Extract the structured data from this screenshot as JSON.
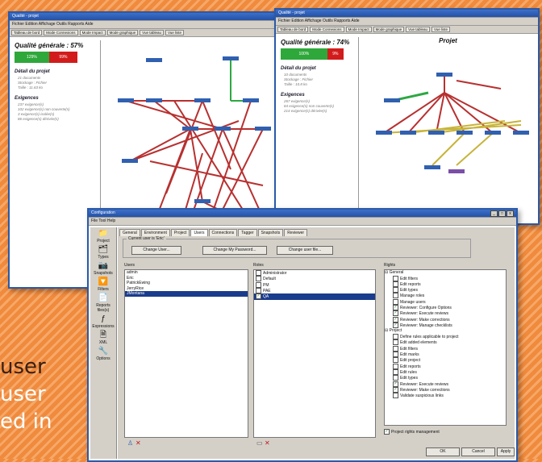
{
  "slide": {
    "line1": "user",
    "line2": "user",
    "line3": "ed in"
  },
  "win1": {
    "title": "Qualité - projet",
    "menu": "Fichier Edition Affichage Outils Rapports Aide",
    "tabs": [
      "Tableau de bord",
      "Mode Connexions",
      "Mode Impact",
      "Mode graphique",
      "Vue tableau",
      "Vue liste"
    ],
    "quality": "Qualité générale : 57%",
    "bar_pass": "129%",
    "bar_fail": "99%",
    "detail_title": "Détail du projet",
    "detail": [
      "21 documents",
      "Stockage : Fichier",
      "Taille : 11.63 ko"
    ],
    "req_title": "Exigences",
    "req": [
      "237 exigence(s)",
      "102 exigence(s) non couverte(s)",
      "3 exigence(s) isolée(s)",
      "86 exigence(s) dérivée(s)"
    ]
  },
  "win2": {
    "title": "Qualité - projet",
    "menu": "Fichier Edition Affichage Outils Rapports Aide",
    "tabs": [
      "Tableau de bord",
      "Mode Connexions",
      "Mode Impact",
      "Mode graphique",
      "Vue tableau",
      "Vue liste"
    ],
    "quality": "Qualité générale : 74%",
    "bar_pass": "100%",
    "bar_fail": "9%",
    "detail_title": "Détail du projet",
    "detail": [
      "10 documents",
      "Stockage : Fichier",
      "Taille : 10.8 ko"
    ],
    "req_title": "Exigences",
    "req": [
      "267 exigence(s)",
      "84 exigence(s) non couverte(s)",
      "214 exigence(s) dérivée(s)"
    ],
    "canvas_title": "Projet"
  },
  "config": {
    "title": "Configuration",
    "menu": [
      "File",
      "Tool",
      "Help"
    ],
    "sidebar": [
      "Project",
      "Types",
      "Snapshots",
      "Filters",
      "Reports files(s)",
      "Expressions",
      "XML",
      "Options"
    ],
    "tabs": [
      "General",
      "Environment",
      "Project",
      "Users",
      "Connections",
      "Tagger",
      "Snapshots",
      "Reviewer"
    ],
    "current_user_label": "Current user is 'Eric'",
    "buttons": [
      "Change User...",
      "Change My Password...",
      "Change user file..."
    ],
    "users_label": "Users",
    "users": [
      "admin",
      "Eric",
      "PatrickEwing",
      "JerryRice",
      "JMontana"
    ],
    "roles_label": "Roles",
    "roles": [
      {
        "label": "Administrator",
        "checked": false
      },
      {
        "label": "Default",
        "checked": false
      },
      {
        "label": "PM",
        "checked": false
      },
      {
        "label": "PAE",
        "checked": false
      },
      {
        "label": "QA",
        "checked": true
      }
    ],
    "rights_label": "Rights",
    "rights_general": "General",
    "rights_g": [
      {
        "label": "Edit filters",
        "checked": false
      },
      {
        "label": "Edit reports",
        "checked": false
      },
      {
        "label": "Edit types",
        "checked": false
      },
      {
        "label": "Manage roles",
        "checked": false
      },
      {
        "label": "Manage users",
        "checked": false
      },
      {
        "label": "Reviewer: Configure Options",
        "checked": true
      },
      {
        "label": "Reviewer: Execute reviews",
        "checked": true
      },
      {
        "label": "Reviewer: Make corrections",
        "checked": true
      },
      {
        "label": "Reviewer: Manage checklists",
        "checked": true
      }
    ],
    "rights_project": "Project",
    "rights_p": [
      {
        "label": "Define rules applicable to project",
        "checked": false
      },
      {
        "label": "Edit added elements",
        "checked": false
      },
      {
        "label": "Edit filters",
        "checked": false
      },
      {
        "label": "Edit marks",
        "checked": false
      },
      {
        "label": "Edit project",
        "checked": false
      },
      {
        "label": "Edit reports",
        "checked": false
      },
      {
        "label": "Edit rules",
        "checked": false
      },
      {
        "label": "Edit types",
        "checked": false
      },
      {
        "label": "Reviewer: Execute reviews",
        "checked": true
      },
      {
        "label": "Reviewer: Make corrections",
        "checked": true
      },
      {
        "label": "Validate suspicious links",
        "checked": false
      }
    ],
    "project_rights_mgmt": "Project rights management",
    "ok": "OK",
    "cancel": "Cancel",
    "apply": "Apply"
  }
}
